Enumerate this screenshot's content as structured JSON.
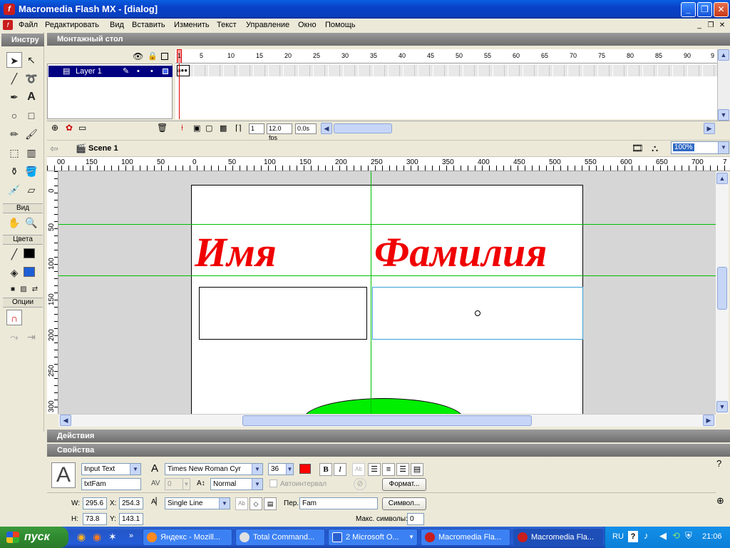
{
  "window": {
    "title": "Macromedia Flash MX - [dialog]",
    "app_icon": "flash-icon",
    "controls": [
      "_",
      "❐",
      "✕"
    ]
  },
  "menu": {
    "items": [
      "Файл",
      "Редактировать",
      "Вид",
      "Вставить",
      "Изменить",
      "Текст",
      "Управление",
      "Окно",
      "Помощь"
    ],
    "mdi_controls": [
      "_",
      "❐",
      "✕"
    ]
  },
  "tools": {
    "header": "Инстру",
    "view_label": "Вид",
    "colors_label": "Цвета",
    "options_label": "Опции",
    "stroke_color": "#000000",
    "fill_color": "#1f5fd6"
  },
  "timeline": {
    "header": "Монтажный стол",
    "layer_name": "Layer 1",
    "frame_ticks": [
      "1",
      "5",
      "10",
      "15",
      "20",
      "25",
      "30",
      "35",
      "40",
      "45",
      "50",
      "55",
      "60",
      "65",
      "70",
      "75",
      "80",
      "85",
      "90",
      "9"
    ],
    "current_frame": "1",
    "fps": "12.0 fps",
    "time": "0.0s"
  },
  "scene": {
    "name": "Scene 1",
    "zoom": "100%"
  },
  "rulers": {
    "h_labels": [
      "00",
      "150",
      "100",
      "50",
      "0",
      "50",
      "100",
      "150",
      "200",
      "250",
      "300",
      "350",
      "400",
      "450",
      "500",
      "550",
      "600",
      "650",
      "700",
      "7"
    ],
    "v_labels": [
      "0",
      "50",
      "100",
      "150",
      "200",
      "250",
      "300"
    ]
  },
  "stage": {
    "label_name": "Имя",
    "label_surname": "Фамилия",
    "text_color": "#f00000",
    "ellipse_color": "#00ee00"
  },
  "panels": {
    "actions": "Действия",
    "properties": "Свойства"
  },
  "properties": {
    "text_type": "Input Text",
    "instance_name": "txtFam",
    "font": "Times New Roman Cyr",
    "size": "36",
    "text_color": "#ff0000",
    "bold": "B",
    "italic": "I",
    "kerning": "0",
    "char_position": "Normal",
    "auto_kern": "Автоинтервал",
    "format_button": "Формат...",
    "w_label": "W:",
    "w": "295.6",
    "x_label": "X:",
    "x": "254.3",
    "h_label": "H:",
    "h": "73.8",
    "y_label": "Y:",
    "y": "143.1",
    "line_type": "Single Line",
    "var_label": "Пер.:",
    "var": "Fam",
    "char_button": "Символ...",
    "max_chars_label": "Макс. символы:",
    "max_chars": "0"
  },
  "taskbar": {
    "start": "пуск",
    "tasks": [
      "Яндекс - Mozill...",
      "Total Command...",
      "2 Microsoft O...",
      "Macromedia Fla...",
      "Macromedia Fla..."
    ],
    "lang": "RU",
    "clock": "21:06"
  }
}
